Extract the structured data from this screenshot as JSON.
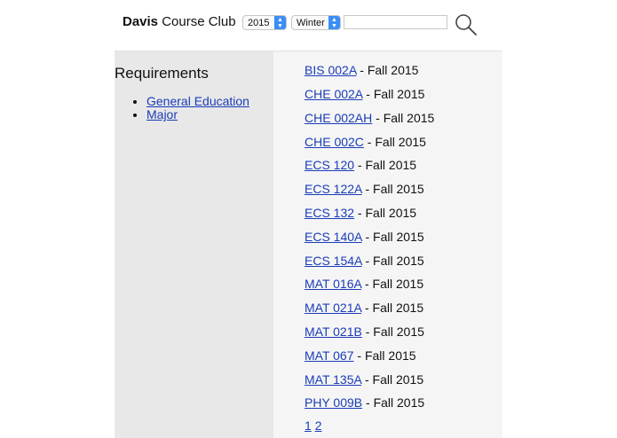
{
  "header": {
    "brand_bold": "Davis",
    "brand_rest": " Course Club",
    "year_select": "2015",
    "term_select": "Winter",
    "search_value": ""
  },
  "sidebar": {
    "title": "Requirements",
    "links": [
      "General Education",
      "Major"
    ]
  },
  "courses": [
    {
      "code": "BIS 002A",
      "term": " - Fall 2015"
    },
    {
      "code": "CHE 002A",
      "term": " - Fall 2015"
    },
    {
      "code": "CHE 002AH",
      "term": " - Fall 2015"
    },
    {
      "code": "CHE 002C",
      "term": " - Fall 2015"
    },
    {
      "code": "ECS 120",
      "term": " - Fall 2015"
    },
    {
      "code": "ECS 122A",
      "term": " - Fall 2015"
    },
    {
      "code": "ECS 132",
      "term": " - Fall 2015"
    },
    {
      "code": "ECS 140A",
      "term": " - Fall 2015"
    },
    {
      "code": "ECS 154A",
      "term": " - Fall 2015"
    },
    {
      "code": "MAT 016A",
      "term": " - Fall 2015"
    },
    {
      "code": "MAT 021A",
      "term": " - Fall 2015"
    },
    {
      "code": "MAT 021B",
      "term": " - Fall 2015"
    },
    {
      "code": "MAT 067",
      "term": " - Fall 2015"
    },
    {
      "code": "MAT 135A",
      "term": " - Fall 2015"
    },
    {
      "code": "PHY 009B",
      "term": " - Fall 2015"
    }
  ],
  "pagination": {
    "pages": [
      "1",
      "2"
    ]
  },
  "colors": {
    "link": "#1a3db8",
    "accent": "#3a8ef6",
    "sidebar_bg": "#e8e8e8",
    "main_bg": "#f5f5f5"
  }
}
